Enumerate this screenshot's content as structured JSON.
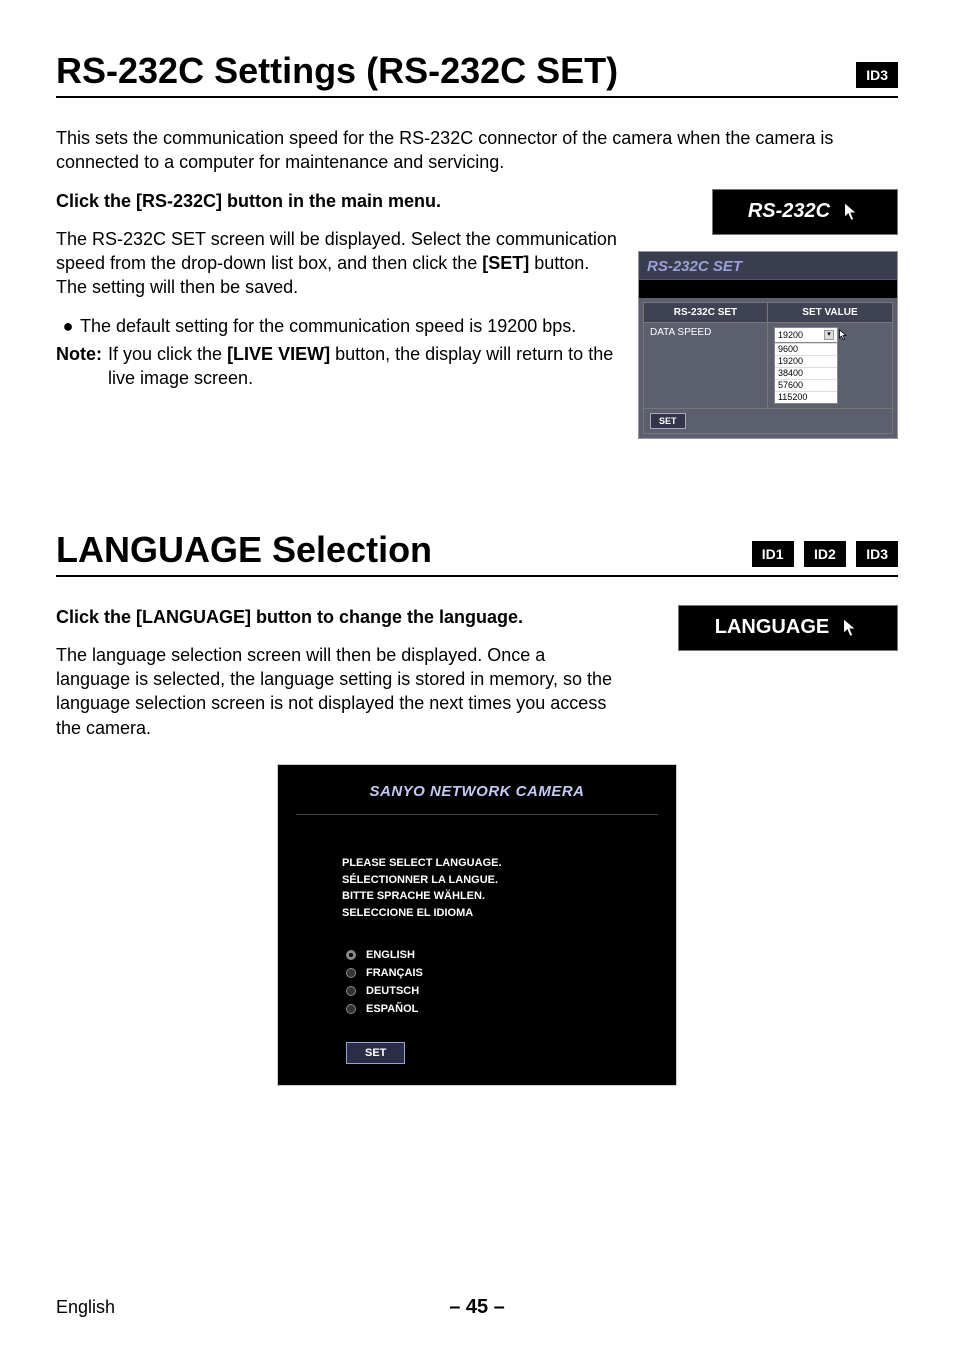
{
  "section1": {
    "title": "RS-232C Settings (RS-232C SET)",
    "badges": [
      "ID3"
    ],
    "intro": "This sets the communication speed for the RS-232C connector of the camera when the camera is connected to a computer for maintenance and servicing.",
    "step_title": "Click the [RS-232C] button in the main menu.",
    "step_body_1": "The RS-232C SET screen will be displayed. Select the communication speed from the drop-down list box, and then click the ",
    "step_body_set": "[SET]",
    "step_body_2": " button. The setting will then be saved.",
    "bullet": "The default setting for the communication speed is 19200 bps.",
    "note_label": "Note:",
    "note_body": "If you click the [LIVE VIEW] button, the display will return to the live image screen.",
    "ui_button": "RS-232C",
    "panel_title": "RS-232C SET",
    "table": {
      "col1": "RS-232C SET",
      "col2": "SET VALUE",
      "row_label": "DATA SPEED",
      "selected": "19200",
      "options": [
        "9600",
        "19200",
        "38400",
        "57600",
        "115200"
      ],
      "set": "SET"
    }
  },
  "section2": {
    "title": "LANGUAGE Selection",
    "badges": [
      "ID1",
      "ID2",
      "ID3"
    ],
    "step_title": "Click the [LANGUAGE] button to change the language.",
    "step_body": "The language selection screen will then be displayed. Once a language is selected, the language setting is stored in memory, so the language selection screen is not displayed the next times you access the camera.",
    "ui_button": "LANGUAGE",
    "panel_title": "SANYO NETWORK CAMERA",
    "instructions": [
      "PLEASE SELECT LANGUAGE.",
      "SÉLECTIONNER LA LANGUE.",
      "BITTE SPRACHE WÄHLEN.",
      "SELECCIONE EL IDIOMA"
    ],
    "options": [
      "ENGLISH",
      "FRANÇAIS",
      "DEUTSCH",
      "ESPAÑOL"
    ],
    "selected": "ENGLISH",
    "set": "SET"
  },
  "footer": {
    "lang": "English",
    "page": "– 45 –"
  }
}
